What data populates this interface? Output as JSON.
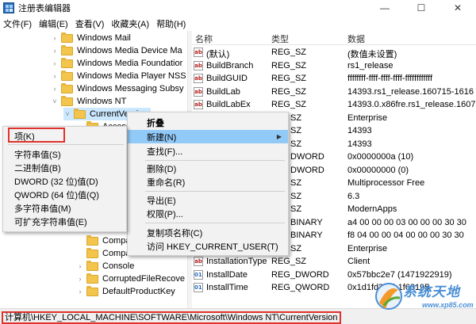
{
  "window": {
    "title": "注册表编辑器",
    "buttons": [
      "—",
      "☐",
      "✕"
    ]
  },
  "menubar": [
    "文件(F)",
    "编辑(E)",
    "查看(V)",
    "收藏夹(A)",
    "帮助(H)"
  ],
  "tree": {
    "items": [
      {
        "label": "Windows Mail",
        "chev": "›"
      },
      {
        "label": "Windows Media Device Ma",
        "chev": "›"
      },
      {
        "label": "Windows Media Foundatior",
        "chev": "›"
      },
      {
        "label": "Windows Media Player NSS",
        "chev": "›"
      },
      {
        "label": "Windows Messaging Subsy",
        "chev": "›"
      },
      {
        "label": "Windows NT",
        "chev": "˅"
      },
      {
        "label": "CurrentVersion",
        "chev": "˅"
      },
      {
        "label": "Accessi",
        "chev": "›"
      }
    ],
    "lower_items": [
      {
        "label": "Compa",
        "chev": ""
      },
      {
        "label": "Compa",
        "chev": ""
      },
      {
        "label": "Console",
        "chev": "›"
      },
      {
        "label": "CorruptedFileRecove",
        "chev": "›"
      },
      {
        "label": "DefaultProductKey",
        "chev": "›"
      }
    ]
  },
  "list": {
    "headers": {
      "name": "名称",
      "type": "类型",
      "data": "数据"
    },
    "rows": [
      {
        "icon": "ab",
        "name": "(默认)",
        "type": "REG_SZ",
        "data": "(数值未设置)"
      },
      {
        "icon": "ab",
        "name": "BuildBranch",
        "type": "REG_SZ",
        "data": "rs1_release"
      },
      {
        "icon": "ab",
        "name": "BuildGUID",
        "type": "REG_SZ",
        "data": "ffffffff-ffff-ffff-ffff-ffffffffffff"
      },
      {
        "icon": "ab",
        "name": "BuildLab",
        "type": "REG_SZ",
        "data": "14393.rs1_release.160715-1616"
      },
      {
        "icon": "ab",
        "name": "BuildLabEx",
        "type": "REG_SZ",
        "data": "14393.0.x86fre.rs1_release.1607"
      },
      {
        "icon": "",
        "name": "",
        "type": "SZ",
        "data": "Enterprise"
      },
      {
        "icon": "",
        "name": "",
        "type": "SZ",
        "data": "14393"
      },
      {
        "icon": "",
        "name": "",
        "type": "SZ",
        "data": "14393"
      },
      {
        "icon": "",
        "name": "",
        "type": "DWORD",
        "data": "0x0000000a (10)"
      },
      {
        "icon": "",
        "name": "",
        "type": "DWORD",
        "data": "0x00000000 (0)"
      },
      {
        "icon": "",
        "name": "",
        "type": "SZ",
        "data": "Multiprocessor Free"
      },
      {
        "icon": "",
        "name": "",
        "type": "SZ",
        "data": "6.3"
      },
      {
        "icon": "",
        "name": "",
        "type": "SZ",
        "data": "ModernApps"
      },
      {
        "icon": "",
        "name": "",
        "type": "BINARY",
        "data": "a4 00 00 00 03 00 00 00 30 30"
      },
      {
        "icon": "",
        "name": "",
        "type": "BINARY",
        "data": "f8 04 00 00 04 00 00 00 30 30"
      },
      {
        "icon": "",
        "name": "",
        "type": "SZ",
        "data": "Enterprise"
      },
      {
        "icon": "ab",
        "name": "InstallationType",
        "type": "REG_SZ",
        "data": "Client"
      },
      {
        "icon": "bin",
        "name": "InstallDate",
        "type": "REG_DWORD",
        "data": "0x57bbc2e7 (1471922919)"
      },
      {
        "icon": "bin",
        "name": "InstallTime",
        "type": "REG_QWORD",
        "data": "0x1d1fd3a4b1f63195"
      }
    ]
  },
  "context_menu_main": [
    {
      "label": "折叠",
      "bold": true
    },
    {
      "label": "新建(N)",
      "submenu": true
    },
    {
      "label": "查找(F)..."
    },
    {
      "label": "删除(D)"
    },
    {
      "label": "重命名(R)"
    },
    {
      "label": "导出(E)"
    },
    {
      "label": "权限(P)..."
    },
    {
      "label": "复制项名称(C)"
    },
    {
      "label": "访问 HKEY_CURRENT_USER(T)"
    }
  ],
  "context_menu_new": [
    {
      "label": "项(K)"
    },
    {
      "label": "字符串值(S)"
    },
    {
      "label": "二进制值(B)"
    },
    {
      "label": "DWORD (32 位)值(D)"
    },
    {
      "label": "QWORD (64 位)值(Q)"
    },
    {
      "label": "多字符串值(M)"
    },
    {
      "label": "可扩充字符串值(E)"
    }
  ],
  "statusbar": {
    "path": "计算机\\HKEY_LOCAL_MACHINE\\SOFTWARE\\Microsoft\\Windows NT\\CurrentVersion"
  },
  "watermark": {
    "text": "系统天地",
    "sub": "www.xp85.com"
  },
  "colors": {
    "highlight": "#91c9f7",
    "selected": "#cce8ff",
    "annotation": "#e0322c"
  }
}
